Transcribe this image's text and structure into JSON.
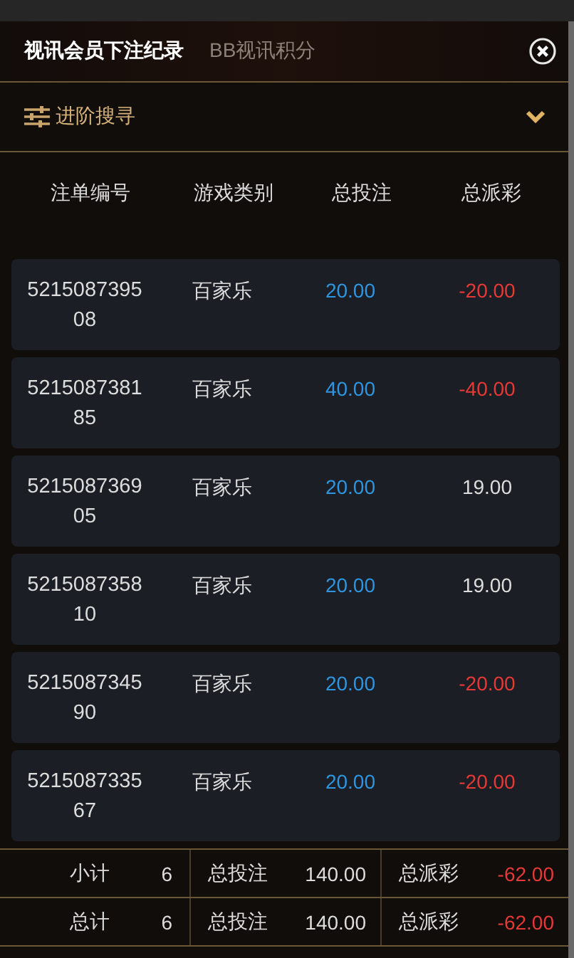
{
  "tabs": [
    {
      "label": "视讯会员下注纪录",
      "selected": true
    },
    {
      "label": "BB视讯积分",
      "selected": false
    }
  ],
  "filter": {
    "label": "进阶搜寻",
    "expanded": false
  },
  "table": {
    "columns": [
      "注单编号",
      "游戏类别",
      "总投注",
      "总派彩"
    ],
    "rows": [
      {
        "bet_id": "521508739508",
        "game": "百家乐",
        "stake": "20.00",
        "payout": "-20.00",
        "negative": true
      },
      {
        "bet_id": "521508738185",
        "game": "百家乐",
        "stake": "40.00",
        "payout": "-40.00",
        "negative": true
      },
      {
        "bet_id": "521508736905",
        "game": "百家乐",
        "stake": "20.00",
        "payout": "19.00",
        "negative": false
      },
      {
        "bet_id": "521508735810",
        "game": "百家乐",
        "stake": "20.00",
        "payout": "19.00",
        "negative": false
      },
      {
        "bet_id": "521508734590",
        "game": "百家乐",
        "stake": "20.00",
        "payout": "-20.00",
        "negative": true
      },
      {
        "bet_id": "521508733567",
        "game": "百家乐",
        "stake": "20.00",
        "payout": "-20.00",
        "negative": true
      }
    ]
  },
  "totals": [
    {
      "label": "小计",
      "count": "6",
      "stake_label": "总投注",
      "stake": "140.00",
      "payout_label": "总派彩",
      "payout": "-62.00",
      "negative": true
    },
    {
      "label": "总计",
      "count": "6",
      "stake_label": "总投注",
      "stake": "140.00",
      "payout_label": "总派彩",
      "payout": "-62.00",
      "negative": true
    }
  ]
}
